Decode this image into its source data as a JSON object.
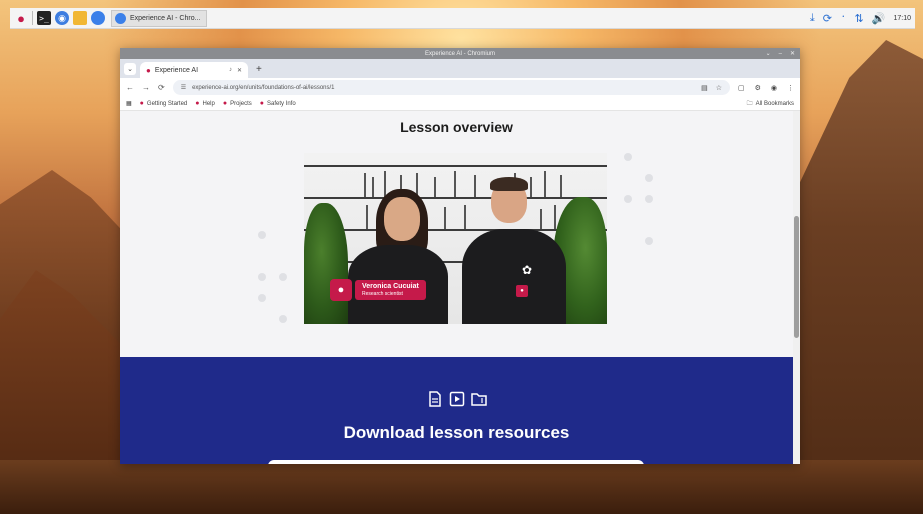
{
  "taskbar": {
    "window_title": "Experience AI - Chro...",
    "clock": "17:10",
    "icons": [
      "raspberry-pi-icon",
      "terminal-icon",
      "globe-icon",
      "folder-icon",
      "chromium-icon"
    ],
    "tray_icons": [
      "download-icon",
      "sync-icon",
      "bluetooth-icon",
      "network-icon",
      "volume-icon"
    ]
  },
  "browser": {
    "window_title": "Experience AI - Chromium",
    "tab": {
      "title": "Experience AI"
    },
    "url": "experience-ai.org/en/units/foundations-of-ai/lessons/1",
    "bookmarks": [
      {
        "label": "Getting Started"
      },
      {
        "label": "Help"
      },
      {
        "label": "Projects"
      },
      {
        "label": "Safety Info"
      }
    ],
    "all_bookmarks": "All Bookmarks"
  },
  "page": {
    "lesson_title": "Lesson overview",
    "video": {
      "presenter_name": "Veronica Cucuiat",
      "presenter_role": "Research scientist"
    },
    "resources_title": "Download lesson resources",
    "resource_icons": [
      "document-icon",
      "video-icon",
      "folder-icon"
    ]
  },
  "colors": {
    "accent": "#c51a4a",
    "resources_bg": "#1f2a8a"
  }
}
